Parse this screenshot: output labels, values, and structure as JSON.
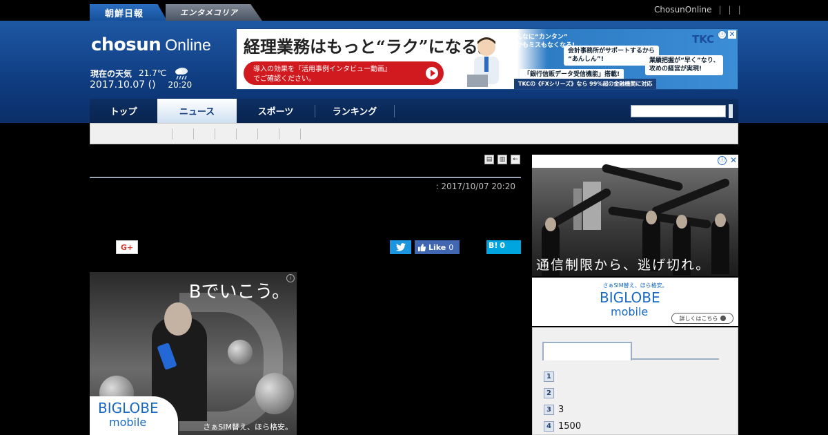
{
  "topbar": {
    "site_tab_chosun": "朝鮮日報",
    "site_tab_entame": "エンタメコリア",
    "right_link": "ChosunOnline",
    "right_separators": [
      "|",
      "|",
      "|"
    ]
  },
  "header": {
    "logo_main": "chosun",
    "logo_sub": "Online",
    "weather_label": "現在の天気",
    "temperature": "21.7℃",
    "date": "2017.10.07 ()",
    "time": "20:20"
  },
  "ad_banner": {
    "headline": "経理業務はもっと“ラク”になる。",
    "cta_line1": "導入の効果を『活用事例インタビュー動画』",
    "cta_line2": "でご確認ください。",
    "box1_line1": "こんなに“カンタン”",
    "box1_line2": "しかもミスもなくなる!",
    "box2_line1": "会計事務所がサポートするから",
    "box2_line2": "“あんしん”!",
    "box3_line1": "業績把握が“早く”なり、",
    "box3_line2": "攻めの経営が実現!",
    "box4": "「銀行信販データ受信機能」搭載!",
    "box5": "TKCの《FXシリーズ》なら 99%超の金融機関に対応",
    "logo": "TKC",
    "info": "ⓘ",
    "close": "✕"
  },
  "nav": {
    "items": [
      {
        "label": "トップ",
        "active": false
      },
      {
        "label": "ニュース",
        "active": true
      },
      {
        "label": "スポーツ",
        "active": false
      },
      {
        "label": "ランキング",
        "active": false
      }
    ],
    "search_placeholder": ""
  },
  "article": {
    "date": ": 2017/10/07 20:20",
    "tools": [
      "▤",
      "▥",
      "←"
    ],
    "share": {
      "gplus": "G+",
      "like_label": "Like",
      "like_count": "0",
      "hatena_label": "B!",
      "hatena_count": "0"
    }
  },
  "article_ad": {
    "copy": "Bでいこう。",
    "brand_line1": "BIGLOBE",
    "brand_line2": "mobile",
    "tagline": "さぁSIM替え、ほら格安。",
    "info": "i"
  },
  "sidebar": {
    "ad1_caption": "通信制限から、逃げ切れ。",
    "ad1_info": "ⓘ",
    "ad1_close": "✕",
    "ad2_tag": "さぁSIM替え、ほら格安。",
    "ad2_brand_line1": "BIGLOBE",
    "ad2_brand_line2": "mobile",
    "ad2_button": "詳しくはこちら",
    "ranking": [
      {
        "num": "1",
        "title": ""
      },
      {
        "num": "2",
        "title": ""
      },
      {
        "num": "3",
        "title": "3"
      },
      {
        "num": "4",
        "title": "1500"
      }
    ]
  }
}
